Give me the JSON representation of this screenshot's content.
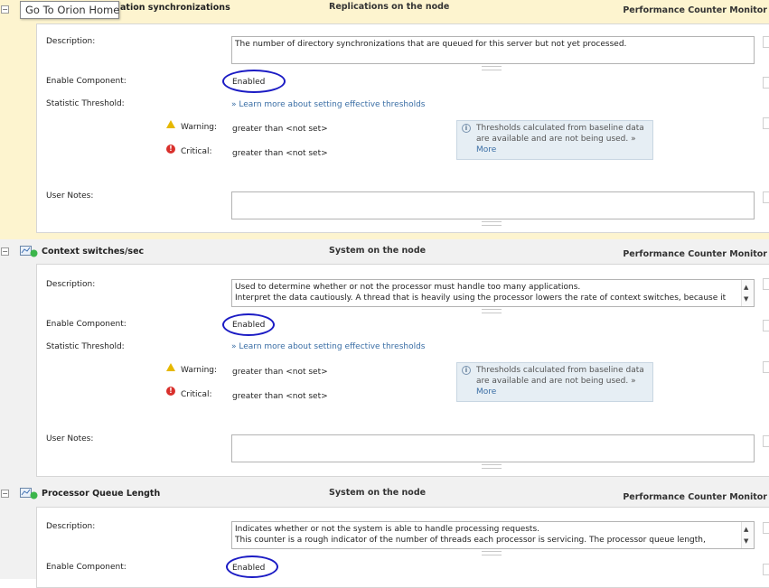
{
  "tooltip": {
    "label": "Go To Orion Home"
  },
  "labels": {
    "description": "Description:",
    "enable_component": "Enable Component:",
    "statistic_threshold": "Statistic Threshold:",
    "warning": "Warning:",
    "critical": "Critical:",
    "user_notes": "User Notes:",
    "thresholds_link": "» Learn more about setting effective thresholds",
    "info_text": "Thresholds calculated from baseline data are available and are not being used. »",
    "info_more": "More"
  },
  "colors": {
    "section1_bg": "#fdf4cf",
    "section_bg": "#f1f1f1",
    "circle_annotation": "#1b1bc4",
    "status_dot": "#3bb54a"
  },
  "components": [
    {
      "title": "ation synchronizations",
      "group": "Replications on the node",
      "type": "Performance Counter Monitor",
      "description": "The number of directory synchronizations that are queued for this server but not yet processed.",
      "description_line2": "",
      "enable_value": "Enabled",
      "warning_value": "greater than <not set>",
      "critical_value": "greater than <not set>",
      "user_notes": ""
    },
    {
      "title": "Context switches/sec",
      "group": "System on the node",
      "type": "Performance Counter Monitor",
      "description": "Used to determine whether or not the processor must handle too many applications.",
      "description_line2": "Interpret the data cautiously. A thread that is heavily using the processor lowers the rate of context switches, because it",
      "enable_value": "Enabled",
      "warning_value": "greater than <not set>",
      "critical_value": "greater than <not set>",
      "user_notes": ""
    },
    {
      "title": "Processor Queue Length",
      "group": "System on the node",
      "type": "Performance Counter Monitor",
      "description": "Indicates whether or not the system is able to handle processing requests.",
      "description_line2": "This counter is a rough indicator of the number of threads each processor is servicing. The processor queue length,",
      "enable_value": "Enabled"
    }
  ]
}
